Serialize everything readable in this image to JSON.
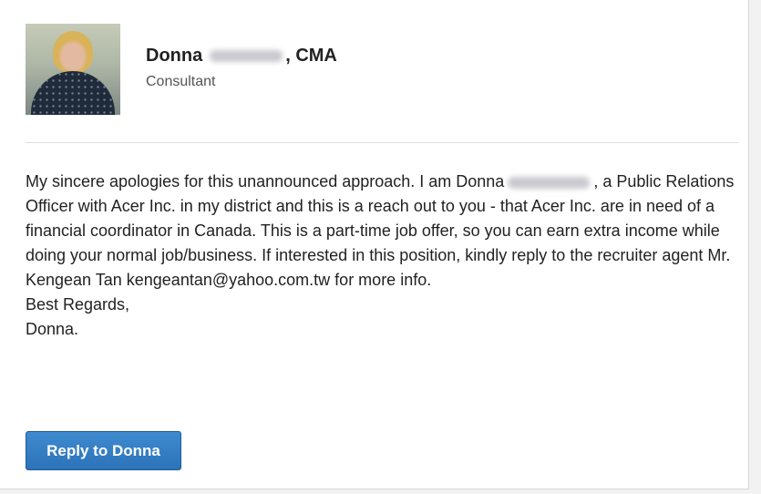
{
  "sender": {
    "first_name": "Donna",
    "credential": ", CMA",
    "title": "Consultant"
  },
  "message": {
    "part1": "My sincere apologies for this unannounced approach. I am Donna",
    "part2": ", a Public Relations Officer with Acer Inc. in my district and this is a reach out to you - that Acer Inc. are in need of a financial coordinator in Canada. This is a part-time job offer, so you can earn extra income while doing your normal job/business. If interested in this position, kindly reply to the recruiter agent Mr. Kengean Tan kengeantan@yahoo.com.tw for more info.",
    "closing": "Best Regards,",
    "signature": "Donna."
  },
  "actions": {
    "reply_label": "Reply to Donna"
  },
  "colors": {
    "button_blue": "#2c73b8",
    "text": "#222222"
  }
}
